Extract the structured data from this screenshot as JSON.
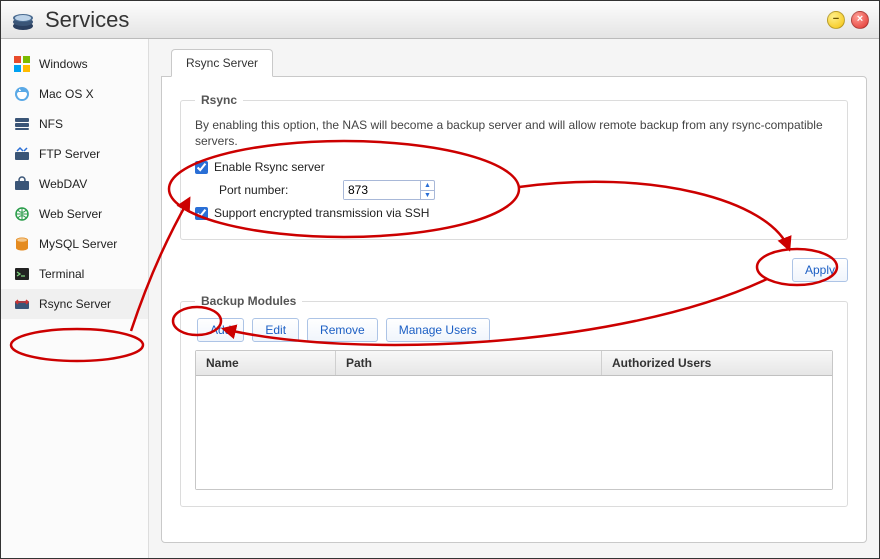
{
  "window": {
    "title": "Services"
  },
  "sidebar": {
    "items": [
      {
        "label": "Windows",
        "icon": "windows-icon",
        "selected": false
      },
      {
        "label": "Mac OS X",
        "icon": "mac-icon",
        "selected": false
      },
      {
        "label": "NFS",
        "icon": "nfs-icon",
        "selected": false
      },
      {
        "label": "FTP Server",
        "icon": "ftp-icon",
        "selected": false
      },
      {
        "label": "WebDAV",
        "icon": "webdav-icon",
        "selected": false
      },
      {
        "label": "Web Server",
        "icon": "web-icon",
        "selected": false
      },
      {
        "label": "MySQL Server",
        "icon": "mysql-icon",
        "selected": false
      },
      {
        "label": "Terminal",
        "icon": "terminal-icon",
        "selected": false
      },
      {
        "label": "Rsync Server",
        "icon": "rsync-icon",
        "selected": true
      }
    ]
  },
  "tab": {
    "label": "Rsync Server"
  },
  "rsync": {
    "legend": "Rsync",
    "description": "By enabling this option, the NAS will become a backup server and will allow remote backup from any rsync-compatible servers.",
    "enable_label": "Enable Rsync server",
    "enable_checked": true,
    "port_label": "Port number:",
    "port_value": "873",
    "ssh_label": "Support encrypted transmission via SSH",
    "ssh_checked": true
  },
  "apply": {
    "label": "Apply"
  },
  "modules": {
    "legend": "Backup Modules",
    "buttons": {
      "add": "Add",
      "edit": "Edit",
      "remove": "Remove",
      "manage": "Manage Users"
    },
    "columns": {
      "name": "Name",
      "path": "Path",
      "authorized": "Authorized Users"
    }
  }
}
